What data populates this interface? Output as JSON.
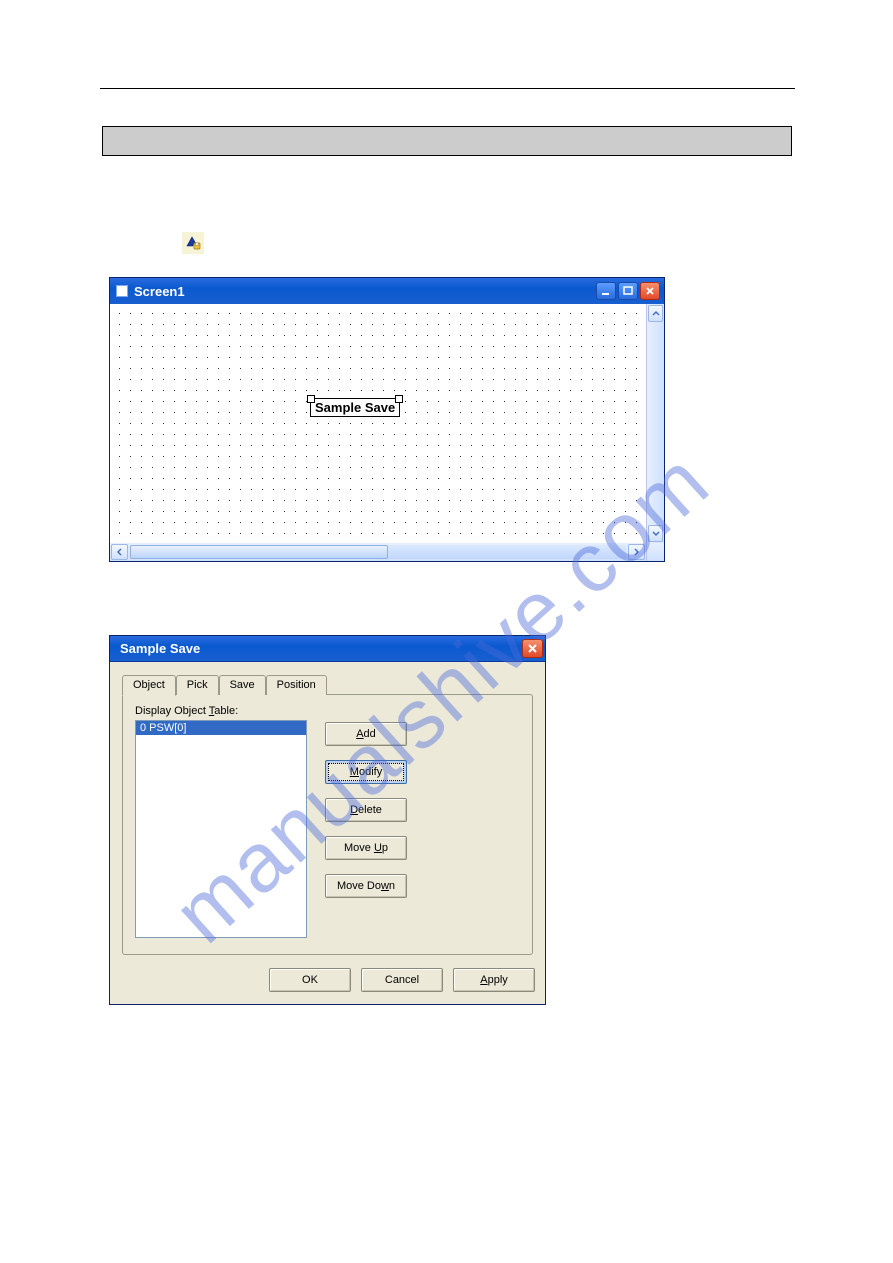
{
  "watermark": "manualshive.com",
  "screen1": {
    "title": "Screen1",
    "object_label": "Sample Save"
  },
  "dialog": {
    "title": "Sample Save",
    "tabs": {
      "object": "Object",
      "pick": "Pick",
      "save": "Save",
      "position": "Position"
    },
    "list_label_pre": "Display Object ",
    "list_label_u": "T",
    "list_label_post": "able:",
    "list_items": [
      "0  PSW[0]"
    ],
    "buttons": {
      "add_u": "A",
      "add_post": "dd",
      "modify_u": "M",
      "modify_post": "odify",
      "delete_u": "D",
      "delete_post": "elete",
      "moveup_pre": "Move ",
      "moveup_u": "U",
      "moveup_post": "p",
      "movedown_pre": "Move Do",
      "movedown_u": "w",
      "movedown_post": "n",
      "ok": "OK",
      "cancel": "Cancel",
      "apply_u": "A",
      "apply_post": "pply"
    }
  }
}
